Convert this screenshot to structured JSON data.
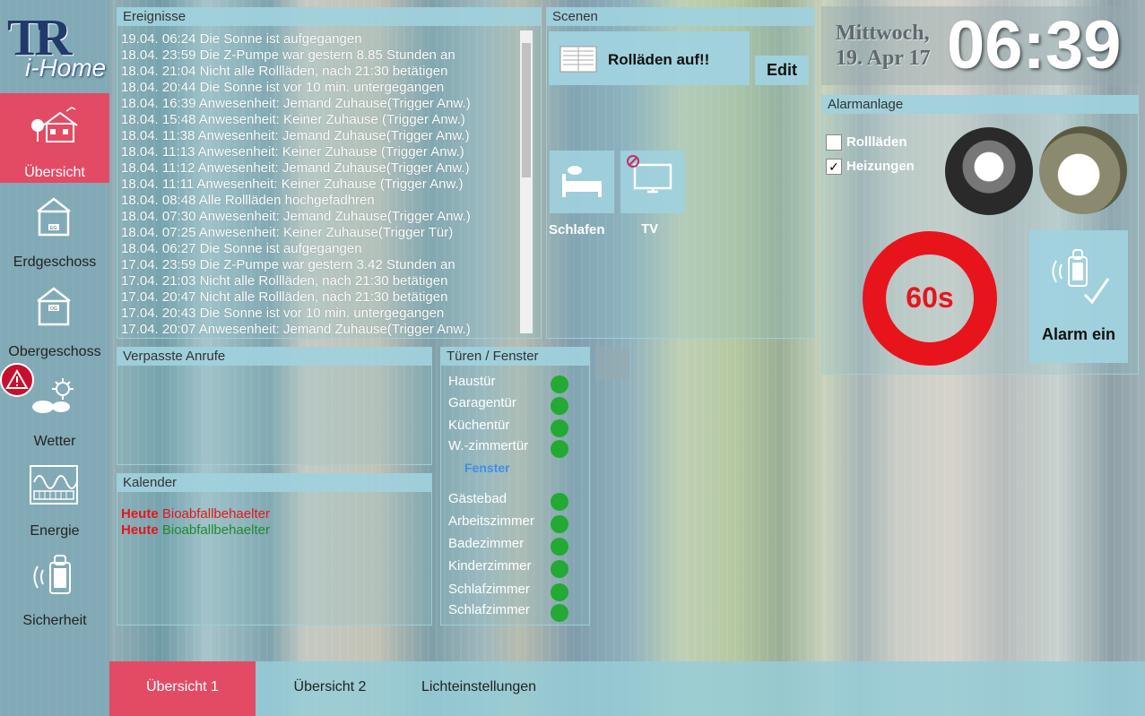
{
  "logo": {
    "mark": "TR",
    "wordmark": "i-Home"
  },
  "sidebar": {
    "items": [
      {
        "label": "Übersicht",
        "icon": "house-garden-icon",
        "active": true
      },
      {
        "label": "Erdgeschoss",
        "icon": "house-eg-icon",
        "badge": "EG"
      },
      {
        "label": "Obergeschoss",
        "icon": "house-og-icon",
        "badge": "OG"
      },
      {
        "label": "Wetter",
        "icon": "weather-icon"
      },
      {
        "label": "Energie",
        "icon": "energy-meter-icon"
      },
      {
        "label": "Sicherheit",
        "icon": "security-remote-icon"
      }
    ]
  },
  "events": {
    "title": "Ereignisse",
    "entries": [
      "19.04. 06:24 Die Sonne ist aufgegangen",
      "18.04. 23:59 Die Z-Pumpe war gestern 8.85 Stunden an",
      "18.04. 21:04 Nicht alle Rollläden, nach 21:30 betätigen",
      "18.04. 20:44 Die Sonne ist vor 10 min. untergegangen",
      "18.04. 16:39 Anwesenheit: Jemand Zuhause(Trigger Anw.)",
      "18.04. 15:48 Anwesenheit: Keiner Zuhause (Trigger Anw.)",
      "18.04. 11:38 Anwesenheit: Jemand Zuhause(Trigger Anw.)",
      "18.04. 11:13 Anwesenheit: Keiner Zuhause (Trigger Anw.)",
      "18.04. 11:12 Anwesenheit: Jemand Zuhause(Trigger Anw.)",
      "18.04. 11:11 Anwesenheit: Keiner Zuhause (Trigger Anw.)",
      "18.04. 08:48 Alle Rollläden hochgefadhren",
      "18.04. 07:30 Anwesenheit: Jemand Zuhause(Trigger Anw.)",
      "18.04. 07:25 Anwesenheit: Keiner Zuhause(Trigger Tür)",
      "18.04. 06:27 Die Sonne ist aufgegangen",
      "17.04. 23:59 Die Z-Pumpe war gestern 3.42 Stunden an",
      "17.04. 21:03 Nicht alle Rollläden, nach 21:30 betätigen",
      "17.04. 20:47 Nicht alle Rollläden, nach 21:30 betätigen",
      "17.04. 20:43 Die Sonne ist vor 10 min. untergegangen",
      "17.04. 20:07 Anwesenheit: Jemand Zuhause(Trigger Anw.)"
    ]
  },
  "scenes": {
    "title": "Scenen",
    "main_button": "Rolläden auf!!",
    "edit_button": "Edit",
    "tiles": [
      {
        "label": "Schlafen",
        "icon": "bed-icon"
      },
      {
        "label": "TV",
        "icon": "tv-icon"
      }
    ]
  },
  "missed_calls": {
    "title": "Verpasste Anrufe"
  },
  "calendar": {
    "title": "Kalender",
    "entries": [
      {
        "when": "Heute",
        "what": "Bioabfallbehaelter",
        "color": "#e8141c"
      },
      {
        "when": "Heute",
        "what": "Bioabfallbehaelter",
        "color": "#1f8a2a"
      }
    ]
  },
  "doors": {
    "title": "Türen / Fenster",
    "doors": [
      "Haustür",
      "Garagentür",
      "Küchentür",
      "W.-zimmertür"
    ],
    "windows_label": "Fenster",
    "windows": [
      "Gästebad",
      "Arbeitszimmer",
      "Badezimmer",
      "Kinderzimmer",
      "Schlafzimmer",
      "Schlafzimmer"
    ],
    "status_color": "#22aa33"
  },
  "clock": {
    "weekday": "Mittwoch,",
    "date": "19. Apr 17",
    "time": "06:39"
  },
  "alarm": {
    "title": "Alarmanlage",
    "options": [
      {
        "label": "Rollläden",
        "checked": false
      },
      {
        "label": "Heizungen",
        "checked": true
      }
    ],
    "countdown": "60s",
    "countdown_color": "#e8141c",
    "button": "Alarm ein"
  },
  "bottom_tabs": [
    {
      "label": "Übersicht 1",
      "active": true
    },
    {
      "label": "Übersicht 2",
      "active": false
    },
    {
      "label": "Lichteinstellungen",
      "active": false
    }
  ],
  "colors": {
    "accent": "#e34b64",
    "panel_header": "#a0d2de",
    "ok": "#22aa33",
    "alarm": "#e8141c"
  }
}
